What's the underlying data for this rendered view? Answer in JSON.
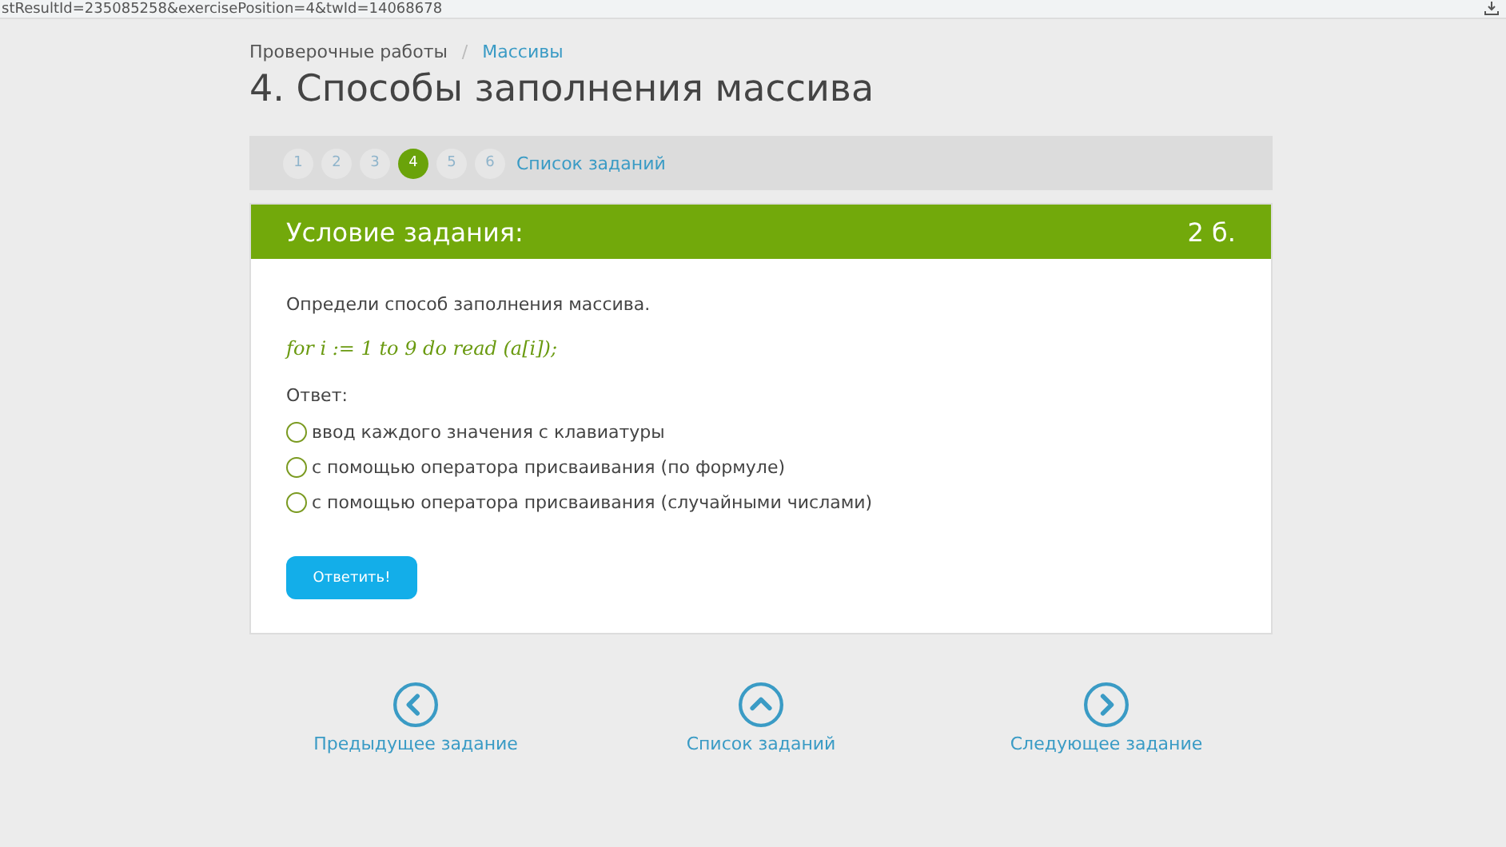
{
  "address_bar": {
    "url": "stResultId=235085258&exercisePosition=4&twId=14068678"
  },
  "breadcrumbs": [
    {
      "label": "Проверочные работы",
      "link": false
    },
    {
      "label": "Массивы",
      "link": true
    }
  ],
  "breadcrumb_separator": "/",
  "title": "4. Способы заполнения массива",
  "pager": {
    "pages": [
      {
        "label": "1",
        "selected": false
      },
      {
        "label": "2",
        "selected": false
      },
      {
        "label": "3",
        "selected": false
      },
      {
        "label": "4",
        "selected": true
      },
      {
        "label": "5",
        "selected": false
      },
      {
        "label": "6",
        "selected": false
      }
    ],
    "list_link": "Список заданий"
  },
  "task": {
    "header": "Условие задания:",
    "points": "2 б.",
    "question": "Определи способ заполнения массива.",
    "formula": "for i := 1 to 9 do read (a[i]);",
    "answer_label": "Ответ:",
    "options": [
      {
        "label": "ввод каждого значения с клавиатуры",
        "selected": false
      },
      {
        "label": "с помощью оператора присваивания (по формуле)",
        "selected": false
      },
      {
        "label": "с помощью оператора присваивания (случайными числами)",
        "selected": false
      }
    ],
    "submit": "Ответить!"
  },
  "navigation": [
    {
      "kind": "prev",
      "label": "Предыдущее задание"
    },
    {
      "kind": "list",
      "label": "Список заданий"
    },
    {
      "kind": "next",
      "label": "Следующее задание"
    }
  ]
}
